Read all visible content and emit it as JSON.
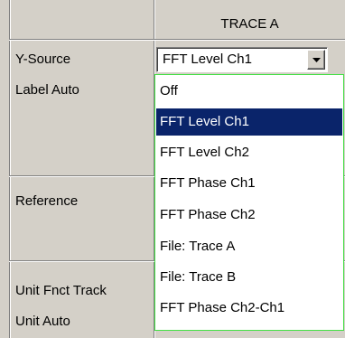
{
  "header": {
    "title": "TRACE A"
  },
  "labels": {
    "y_source": "Y-Source",
    "label_auto": "Label Auto",
    "reference": "Reference",
    "unit_fnct_track": "Unit Fnct Track",
    "unit_auto": "Unit Auto"
  },
  "y_source_combo": {
    "value": "FFT Level Ch1",
    "button_icon": "chevron-down-icon"
  },
  "dropdown": {
    "selected_index": 1,
    "options": [
      "Off",
      "FFT Level Ch1",
      "FFT Level Ch2",
      "FFT Phase Ch1",
      "FFT Phase Ch2",
      "File: Trace A",
      "File: Trace B",
      "FFT Phase Ch2-Ch1"
    ]
  },
  "colors": {
    "panel_bg": "#d4d0c8",
    "selection_bg": "#0a246a",
    "dropdown_border": "#44e044"
  }
}
